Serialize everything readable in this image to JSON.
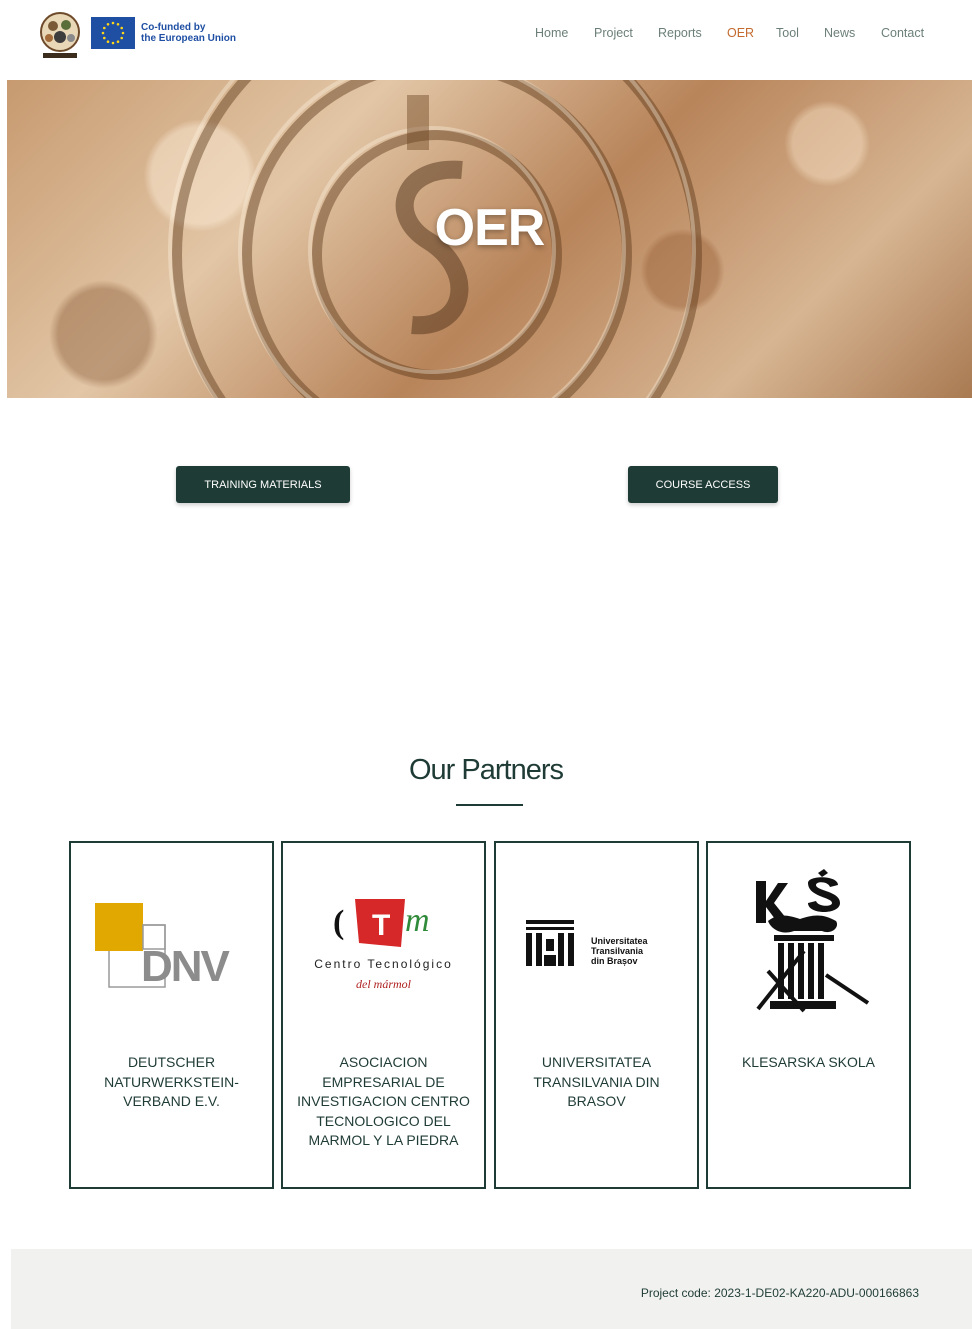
{
  "header": {
    "logo_icon": "rockchain-logo-icon",
    "eu_flag_icon": "eu-flag-icon",
    "eu_text_line1": "Co-funded by",
    "eu_text_line2": "the European Union",
    "nav": [
      {
        "label": "Home"
      },
      {
        "label": "Project"
      },
      {
        "label": "Reports"
      },
      {
        "label": "OER",
        "active": true
      },
      {
        "label": "Tool"
      },
      {
        "label": "News"
      },
      {
        "label": "Contact"
      }
    ]
  },
  "hero": {
    "title": "OER"
  },
  "buttons": {
    "training": "TRAINING MATERIALS",
    "course": "COURSE ACCESS"
  },
  "partners": {
    "title": "Our Partners",
    "items": [
      {
        "name": "DEUTSCHER NATURWERKSTEIN-VERBAND E.V.",
        "logo": "dnv-logo-icon",
        "logo_text": "DNV"
      },
      {
        "name": "ASOCIACION EMPRESARIAL DE INVESTIGACION CENTRO TECNOLOGICO DEL MARMOL Y LA PIEDRA",
        "logo": "ctm-logo-icon",
        "logo_line1": "Centro Tecnológico",
        "logo_line2": "del mármol"
      },
      {
        "name": "UNIVERSITATEA TRANSILVANIA DIN BRASOV",
        "logo": "unitbv-logo-icon",
        "logo_line1": "Universitatea",
        "logo_line2": "Transilvania",
        "logo_line3": "din Brașov"
      },
      {
        "name": "KLESARSKA SKOLA",
        "logo": "klesarska-logo-icon"
      }
    ]
  },
  "footer": {
    "project_code": "Project code: 2023-1-DE02-KA220-ADU-000166863"
  },
  "colors": {
    "primary": "#1f3b35",
    "nav_active": "#c36a2d",
    "nav_text": "#6b7f78",
    "footer_bg": "#f1f2f0"
  }
}
